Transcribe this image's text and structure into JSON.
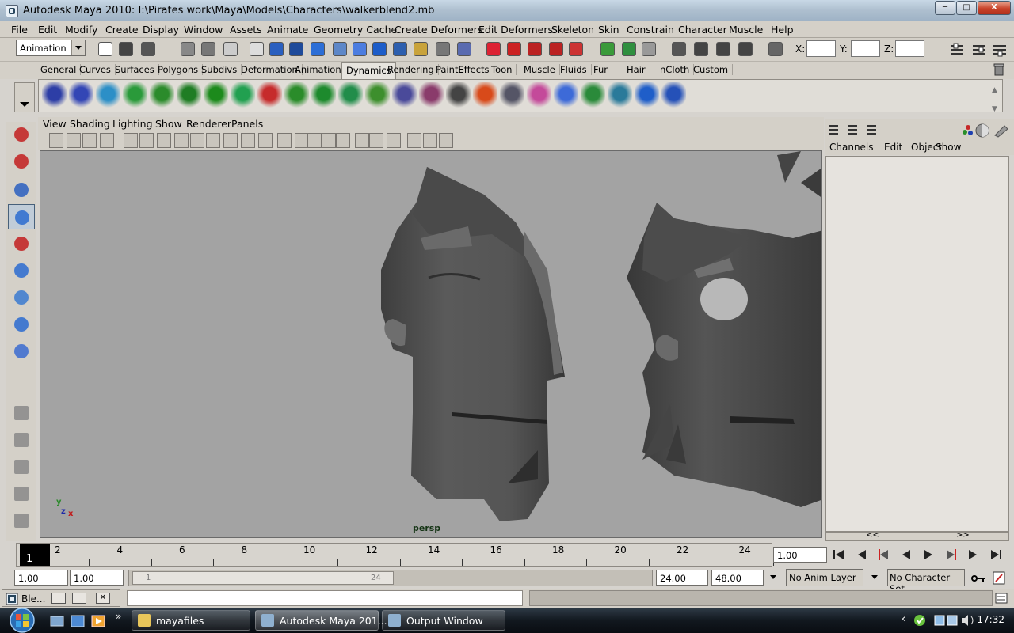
{
  "window": {
    "title": "Autodesk Maya 2010: I:\\Pirates work\\Maya\\Models\\Characters\\walkerblend2.mb",
    "min": "─",
    "max": "□",
    "close": "X"
  },
  "menus": [
    "File",
    "Edit",
    "Modify",
    "Create",
    "Display",
    "Window",
    "Assets",
    "Animate",
    "Geometry Cache",
    "Create Deformers",
    "Edit Deformers",
    "Skeleton",
    "Skin",
    "Constrain",
    "Character",
    "Muscle",
    "Help"
  ],
  "status": {
    "mode": "Animation",
    "x_label": "X:",
    "y_label": "Y:",
    "z_label": "Z:",
    "x": "",
    "y": "",
    "z": ""
  },
  "shelf_tabs": [
    "General",
    "Curves",
    "Surfaces",
    "Polygons",
    "Subdivs",
    "Deformation",
    "Animation",
    "Dynamics",
    "Rendering",
    "PaintEffects",
    "Toon",
    "Muscle",
    "Fluids",
    "Fur",
    "Hair",
    "nCloth",
    "Custom"
  ],
  "active_shelf_tab": "Dynamics",
  "viewport": {
    "menus": [
      "View",
      "Shading",
      "Lighting",
      "Show",
      "Renderer",
      "Panels"
    ],
    "camera_label": "persp",
    "axis": {
      "y": "y",
      "z": "z",
      "x": "x"
    }
  },
  "channel_box": {
    "menus": [
      "Channels",
      "Edit",
      "Object",
      "Show"
    ],
    "scroll_left": "<<",
    "scroll_right": ">>"
  },
  "timeline": {
    "current_frame": "1",
    "ticks": [
      "2",
      "4",
      "6",
      "8",
      "10",
      "12",
      "14",
      "16",
      "18",
      "20",
      "22",
      "24"
    ],
    "current_time_field": "1.00"
  },
  "range": {
    "start_time": "1.00",
    "start_range": "1.00",
    "range_start_marker": "1",
    "range_end_marker": "24",
    "end_range": "24.00",
    "end_time": "48.00"
  },
  "anim_layer": "No Anim Layer",
  "character_set": "No Character Set",
  "cmdline": {
    "mini_window_title": "Ble...",
    "value": ""
  },
  "taskbar": {
    "items": [
      "mayafiles",
      "Autodesk Maya 201...",
      "Output Window"
    ],
    "active": "Autodesk Maya 201...",
    "expand": "»",
    "tray_arrow": "‹",
    "clock": "17:32"
  },
  "colors": {
    "viewport_bg": "#a3a3a3",
    "taskbar": "#1a222b",
    "maya_grey": "#d4d0c8",
    "selected_tool": "#c0ccd8"
  }
}
